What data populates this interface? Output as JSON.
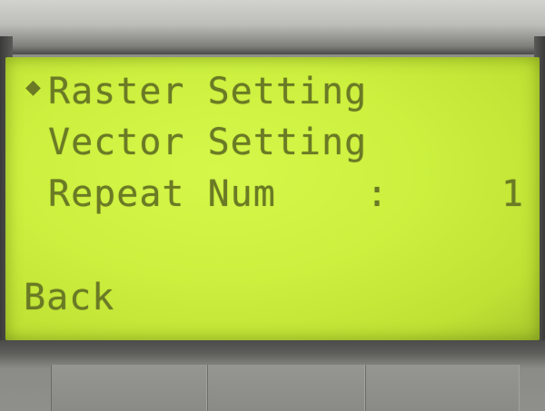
{
  "lcd_menu": {
    "cursor_glyph": "◆",
    "items": [
      {
        "label": "Raster Setting"
      },
      {
        "label": "Vector Setting"
      },
      {
        "label": "Repeat Num",
        "separator": ":",
        "value": "1"
      }
    ],
    "back_label": "Back"
  },
  "colors": {
    "lcd_background": "#cdf03f",
    "lcd_text": "#6a7a25"
  }
}
